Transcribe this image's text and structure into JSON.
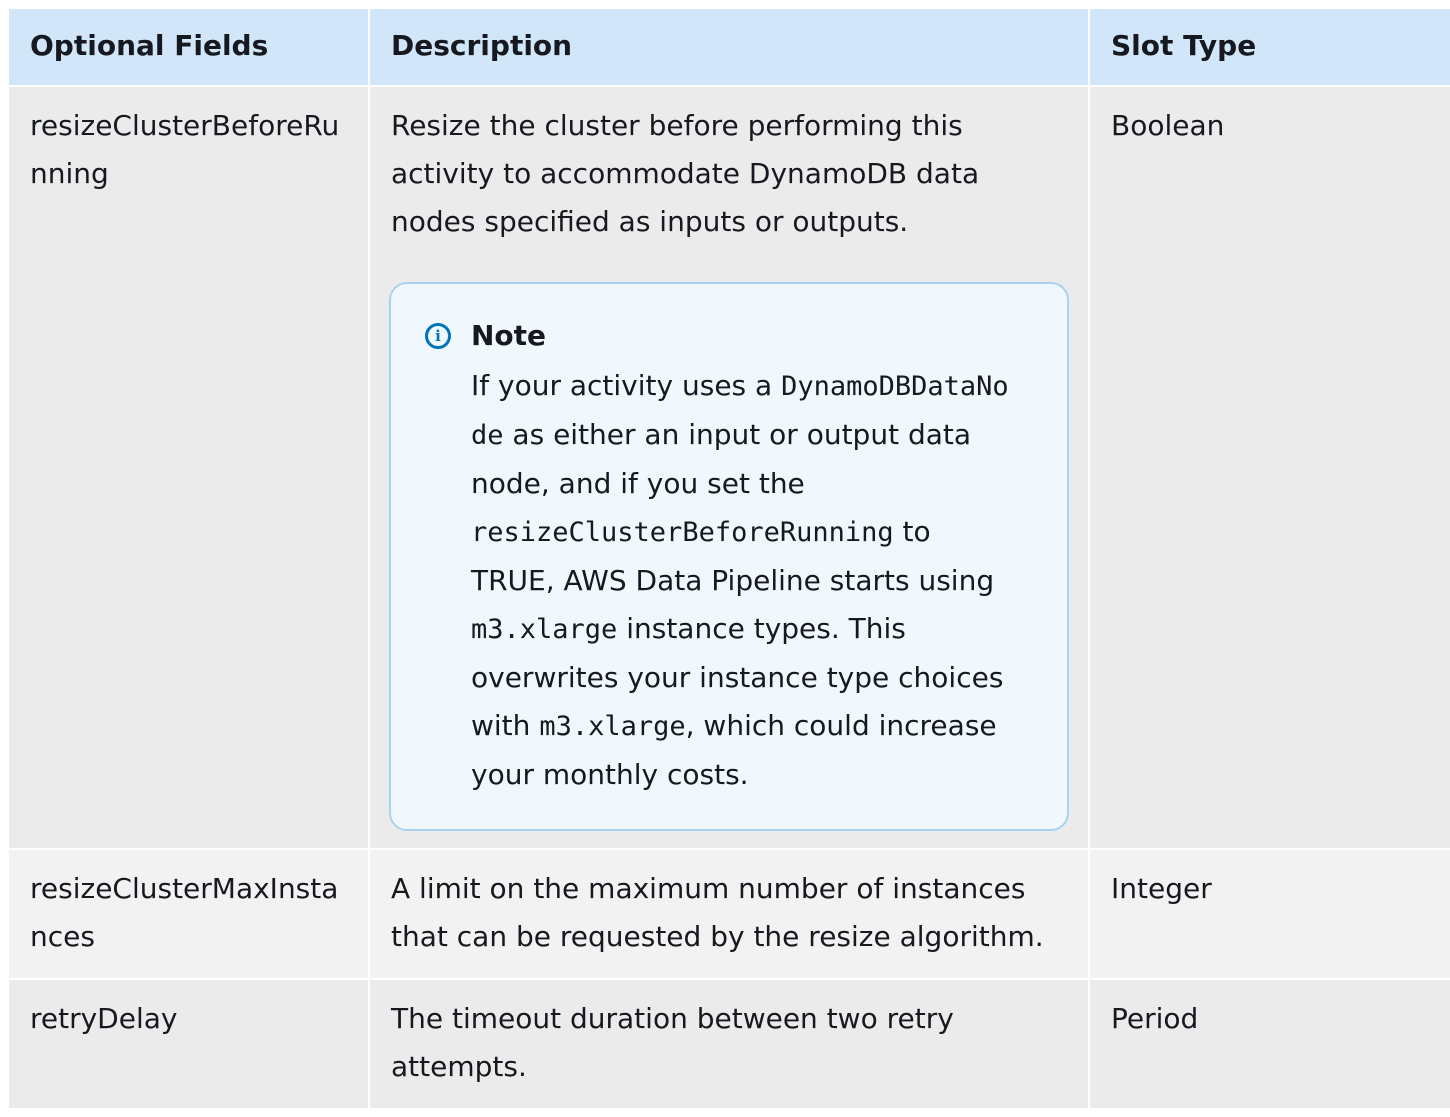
{
  "table": {
    "headers": [
      "Optional Fields",
      "Description",
      "Slot Type"
    ],
    "rows": [
      {
        "field": "resizeClusterBeforeRunning",
        "description": "Resize the cluster before performing this activity to accommodate DynamoDB data nodes specified as inputs or outputs.",
        "slot_type": "Boolean",
        "note": {
          "title": "Note",
          "icon": "info-icon",
          "parts": {
            "t1": "If your activity uses a ",
            "c1": "DynamoDBDataNode",
            "t2": " as either an input or output data node, and if you set the ",
            "c2": "resizeClusterBeforeRunning",
            "t3": " to ",
            "c3": "TRUE",
            "t4": ", AWS Data Pipeline starts using ",
            "c4": "m3.xlarge",
            "t5": " instance types. This overwrites your instance type choices with ",
            "c5": "m3.xlarge",
            "t6": ", which could increase your monthly costs."
          }
        }
      },
      {
        "field": "resizeClusterMaxInstances",
        "description": "A limit on the maximum number of instances that can be requested by the resize algorithm.",
        "slot_type": "Integer"
      },
      {
        "field": "retryDelay",
        "description": "The timeout duration between two retry attempts.",
        "slot_type": "Period"
      }
    ]
  },
  "colors": {
    "header_bg": "#d1e6f8",
    "row_bg": "#ebebeb",
    "note_bg": "#f1f8fd",
    "note_border": "#a9d2f0",
    "icon": "#0073bb"
  }
}
